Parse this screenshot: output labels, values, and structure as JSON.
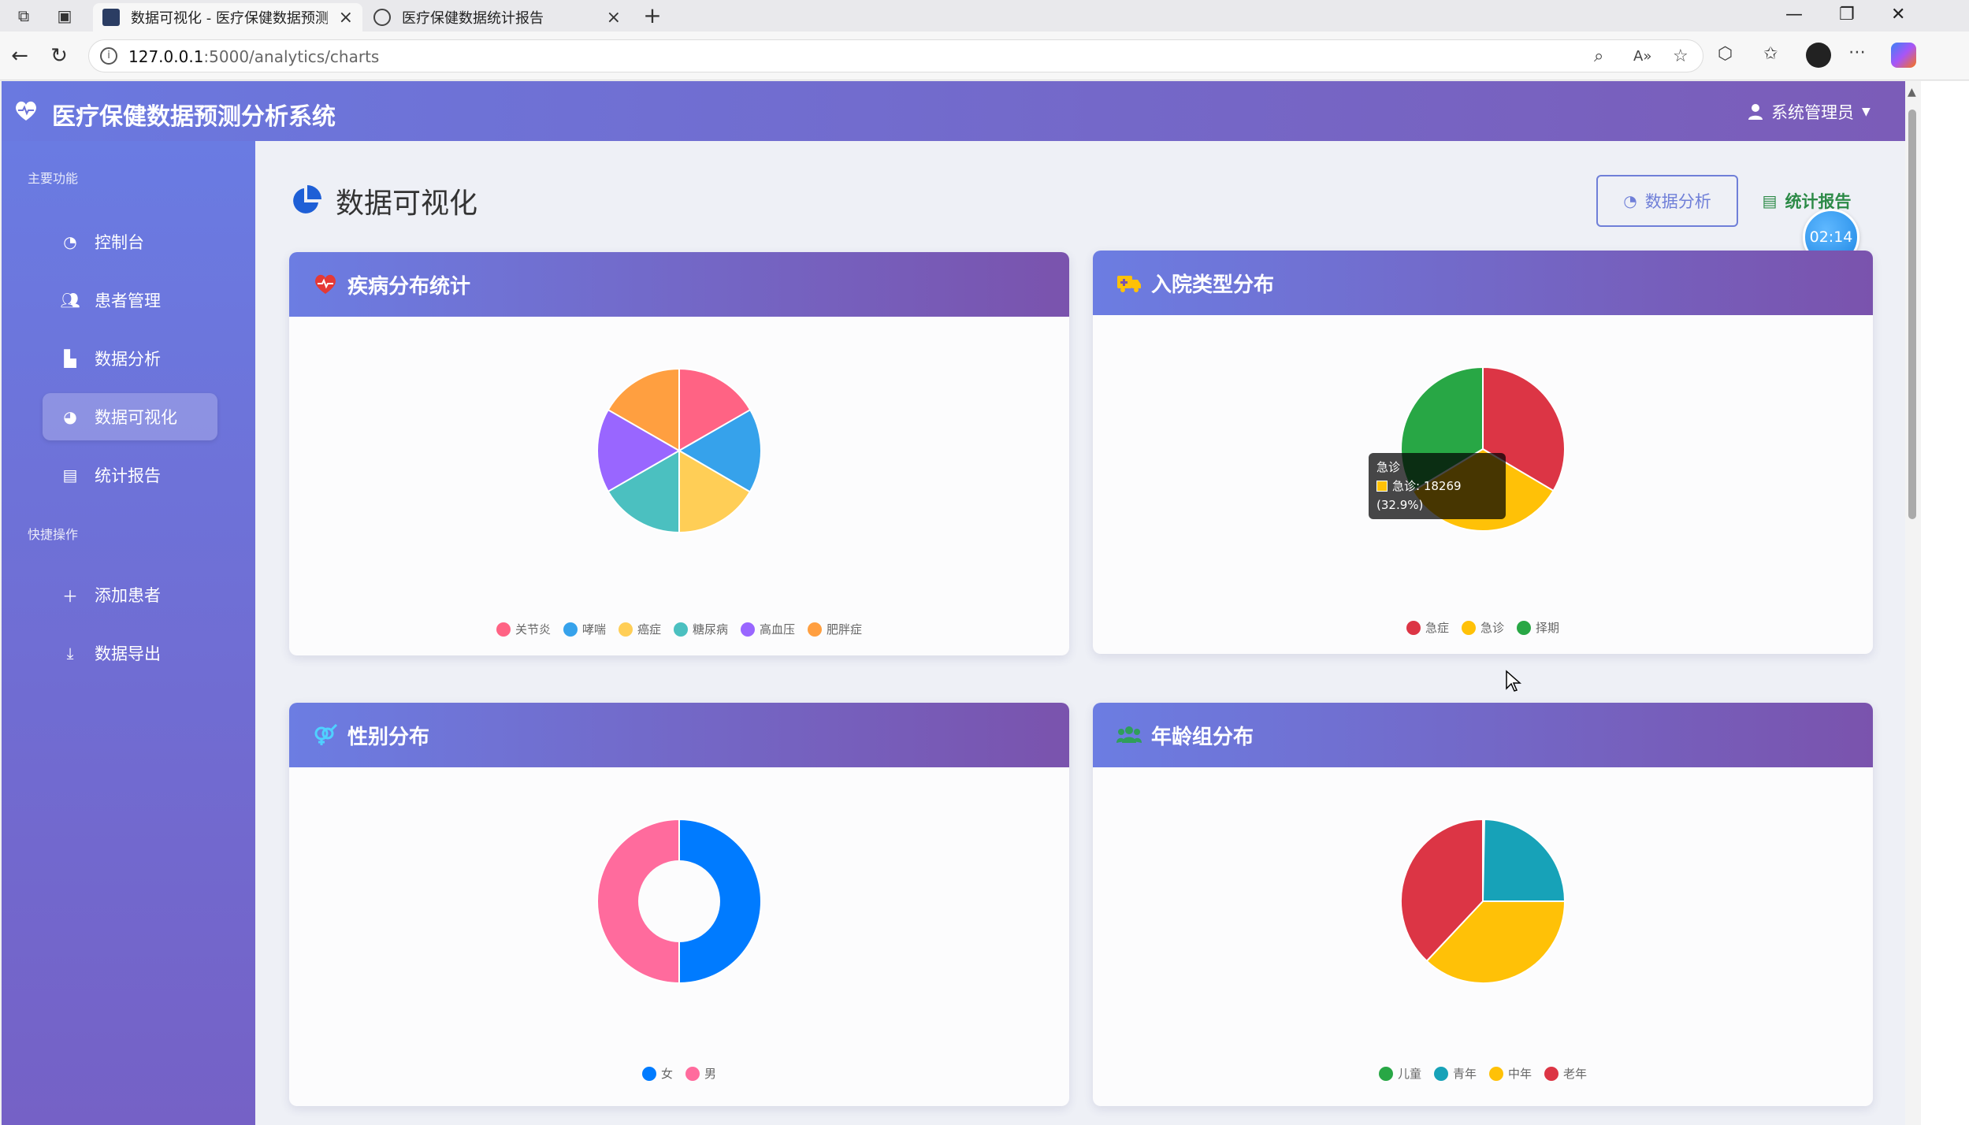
{
  "browser": {
    "tabs": [
      {
        "title": "数据可视化 - 医疗保健数据预测分",
        "active": true
      },
      {
        "title": "医疗保健数据统计报告",
        "active": false
      }
    ],
    "new_tab": "+",
    "url_host": "127.0.0.1",
    "url_rest": ":5000/analytics/charts",
    "win_min": "—",
    "win_restore": "❐",
    "win_close": "✕"
  },
  "app": {
    "brand": "医疗保健数据预测分析系统",
    "user": "系统管理员",
    "timer": "02:14",
    "page_title": "数据可视化",
    "btn_analysis": "数据分析",
    "btn_report": "统计报告"
  },
  "sidebar": {
    "section_main": "主要功能",
    "section_quick": "快捷操作",
    "items": [
      {
        "label": "控制台",
        "icon": "dashboard-icon",
        "active": false
      },
      {
        "label": "患者管理",
        "icon": "users-icon",
        "active": false
      },
      {
        "label": "数据分析",
        "icon": "chart-bar-icon",
        "active": false
      },
      {
        "label": "数据可视化",
        "icon": "chart-pie-icon",
        "active": true
      },
      {
        "label": "统计报告",
        "icon": "file-icon",
        "active": false
      }
    ],
    "quick": [
      {
        "label": "添加患者",
        "icon": "plus-icon"
      },
      {
        "label": "数据导出",
        "icon": "download-icon"
      }
    ]
  },
  "cards": {
    "disease": {
      "title": "疾病分布统计"
    },
    "admission": {
      "title": "入院类型分布"
    },
    "gender": {
      "title": "性别分布"
    },
    "age": {
      "title": "年龄组分布"
    }
  },
  "tooltip": {
    "title": "急诊",
    "line": "急诊: 18269 (32.9%)"
  },
  "colors": {
    "accent": "#6f7fd8",
    "header_start": "#6c7de2",
    "header_end": "#7a53ad"
  },
  "chart_data": [
    {
      "type": "pie",
      "title": "疾病分布统计",
      "categories": [
        "关节炎",
        "哮喘",
        "癌症",
        "糖尿病",
        "高血压",
        "肥胖症"
      ],
      "values": [
        16.7,
        16.7,
        16.6,
        16.7,
        16.6,
        16.7
      ],
      "colors": [
        "#ff6384",
        "#36a2eb",
        "#ffce56",
        "#4bc0c0",
        "#9966ff",
        "#ff9f40"
      ],
      "legend": "bottom"
    },
    {
      "type": "pie",
      "title": "入院类型分布",
      "categories": [
        "急症",
        "急诊",
        "择期"
      ],
      "values": [
        33.5,
        32.9,
        33.6
      ],
      "colors": [
        "#dc3545",
        "#ffc107",
        "#28a745"
      ],
      "legend": "bottom"
    },
    {
      "type": "pie",
      "donut": true,
      "title": "性别分布",
      "categories": [
        "女",
        "男"
      ],
      "values": [
        50.0,
        50.0
      ],
      "colors": [
        "#007bff",
        "#ff6b9d"
      ],
      "legend": "bottom"
    },
    {
      "type": "pie",
      "title": "年龄组分布",
      "categories": [
        "儿童",
        "青年",
        "中年",
        "老年"
      ],
      "values": [
        0.3,
        24.7,
        37.0,
        38.0
      ],
      "colors": [
        "#28a745",
        "#17a2b8",
        "#ffc107",
        "#dc3545"
      ],
      "legend": "bottom"
    }
  ]
}
